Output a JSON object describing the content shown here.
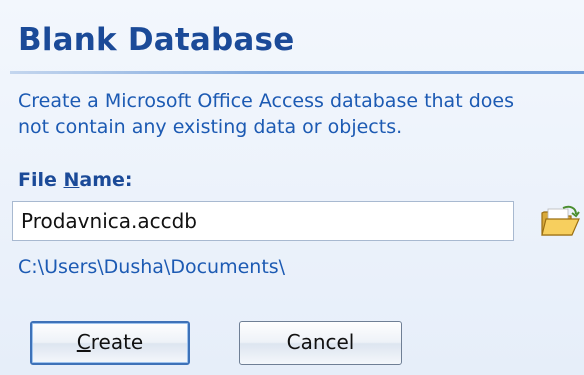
{
  "dialog": {
    "title": "Blank Database",
    "description_line1": "Create a Microsoft Office Access database that does",
    "description_line2": "not contain any existing data or objects.",
    "file_name_label_pre": "File ",
    "file_name_label_underlined": "N",
    "file_name_label_post": "ame:",
    "file_name_value": "Prodavnica.accdb",
    "save_path": "C:\\Users\\Dusha\\Documents\\",
    "browse_icon": "folder-open-icon",
    "create_button_underlined": "C",
    "create_button_rest": "reate",
    "cancel_button_label": "Cancel"
  },
  "colors": {
    "title": "#1b4a98",
    "text": "#1c5ab3",
    "rule": "#7ea7dd",
    "background": "#eaf1fb"
  }
}
